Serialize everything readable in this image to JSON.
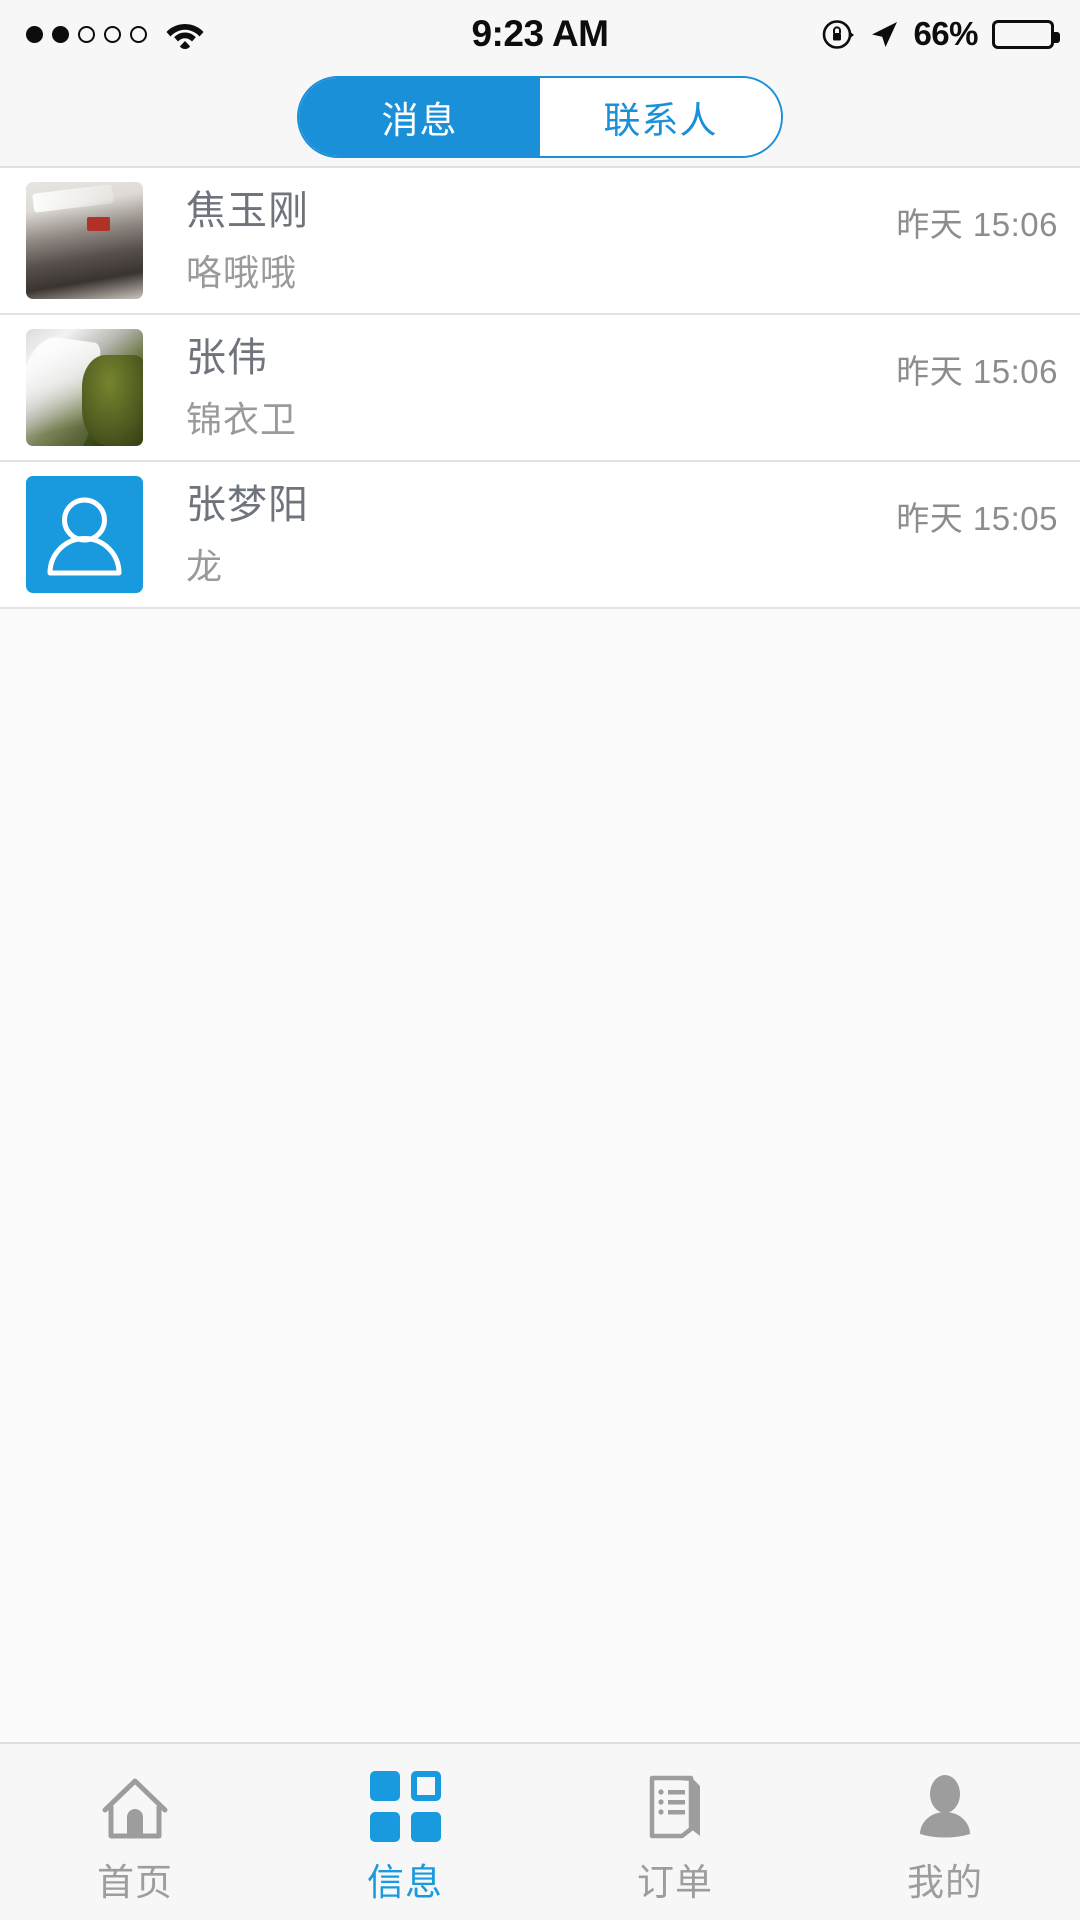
{
  "status_bar": {
    "signal_dots": [
      true,
      true,
      false,
      false,
      false
    ],
    "wifi_icon": "wifi-icon",
    "time": "9:23 AM",
    "rotation_lock_icon": "rotation-lock-icon",
    "location_icon": "location-arrow-icon",
    "battery_percent": "66%",
    "battery_level": 0.66
  },
  "segmented_control": {
    "tabs": [
      {
        "label": "消息",
        "active": true
      },
      {
        "label": "联系人",
        "active": false
      }
    ],
    "accent_color": "#1a90d9"
  },
  "message_list": [
    {
      "avatar_type": "photo-meeting",
      "avatar_name": "avatar-photo-meeting",
      "name": "焦玉刚",
      "message": "咯哦哦",
      "time": "昨天 15:06"
    },
    {
      "avatar_type": "photo-water",
      "avatar_name": "avatar-photo-waterfall",
      "name": "张伟",
      "message": "锦衣卫",
      "time": "昨天 15:06"
    },
    {
      "avatar_type": "default-person",
      "avatar_name": "avatar-default-person",
      "name": "张梦阳",
      "message": "龙",
      "time": "昨天 15:05"
    }
  ],
  "tab_bar": {
    "items": [
      {
        "label": "首页",
        "icon": "home-icon",
        "active": false
      },
      {
        "label": "信息",
        "icon": "grid-icon",
        "active": true
      },
      {
        "label": "订单",
        "icon": "receipt-icon",
        "active": false
      },
      {
        "label": "我的",
        "icon": "person-icon",
        "active": false
      }
    ],
    "active_color": "#1a9ade",
    "inactive_color": "#9d9d9d"
  }
}
